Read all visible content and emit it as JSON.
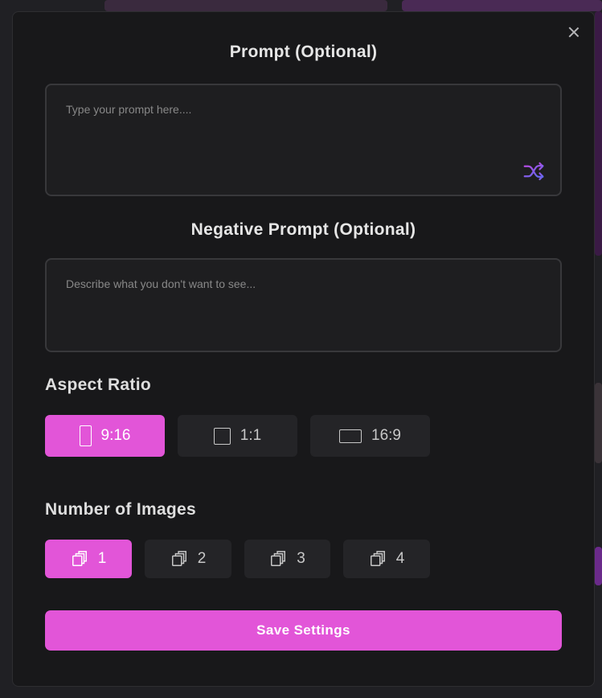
{
  "modal": {
    "prompt_title": "Prompt (Optional)",
    "prompt_placeholder": "Type your prompt here....",
    "negative_title": "Negative Prompt (Optional)",
    "negative_placeholder": "Describe what you don't want to see...",
    "aspect_ratio_label": "Aspect Ratio",
    "aspect_ratios": [
      {
        "label": "9:16",
        "icon": "portrait-rect-icon",
        "selected": true
      },
      {
        "label": "1:1",
        "icon": "square-icon",
        "selected": false
      },
      {
        "label": "16:9",
        "icon": "landscape-rect-icon",
        "selected": false
      }
    ],
    "num_images_label": "Number of Images",
    "num_images": [
      {
        "label": "1",
        "icon": "images-stack-icon",
        "selected": true
      },
      {
        "label": "2",
        "icon": "images-stack-icon",
        "selected": false
      },
      {
        "label": "3",
        "icon": "images-stack-icon",
        "selected": false
      },
      {
        "label": "4",
        "icon": "images-stack-icon",
        "selected": false
      }
    ],
    "save_label": "Save Settings"
  },
  "colors": {
    "accent": "#e255d8",
    "background": "#18181a",
    "shuffle_gradient": [
      "#b44be1",
      "#5b6cf0"
    ]
  }
}
